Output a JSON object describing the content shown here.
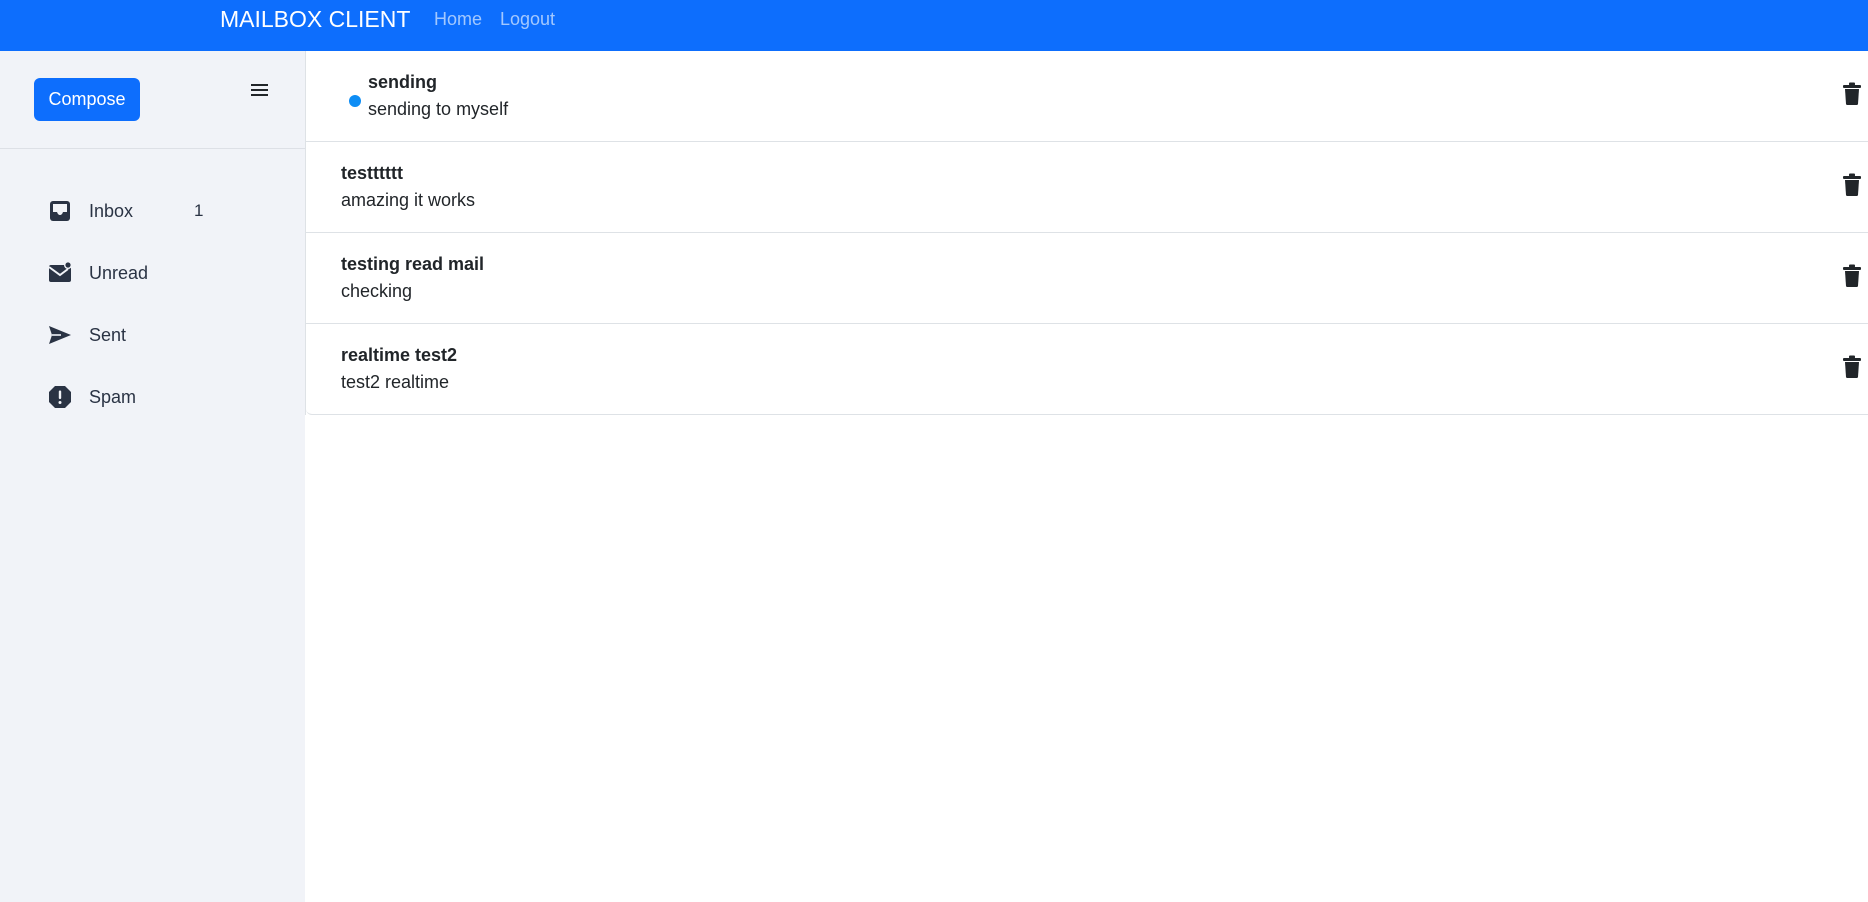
{
  "navbar": {
    "brand": "MAILBOX CLIENT",
    "links": [
      {
        "label": "Home"
      },
      {
        "label": "Logout"
      }
    ]
  },
  "sidebar": {
    "compose_label": "Compose",
    "items": [
      {
        "label": "Inbox",
        "icon": "inbox-icon",
        "count": "1"
      },
      {
        "label": "Unread",
        "icon": "unread-mail-icon"
      },
      {
        "label": "Sent",
        "icon": "send-icon"
      },
      {
        "label": "Spam",
        "icon": "spam-alert-icon"
      }
    ]
  },
  "mails": [
    {
      "subject": "sending",
      "preview": "sending to myself",
      "unread": true
    },
    {
      "subject": "testttttt",
      "preview": "amazing it works",
      "unread": false
    },
    {
      "subject": "testing read mail",
      "preview": "checking",
      "unread": false
    },
    {
      "subject": "realtime test2",
      "preview": "test2 realtime",
      "unread": false
    }
  ],
  "colors": {
    "primary": "#0d6efd",
    "sidebar_bg": "#f1f3f8",
    "unread_dot": "#0d8df5"
  }
}
